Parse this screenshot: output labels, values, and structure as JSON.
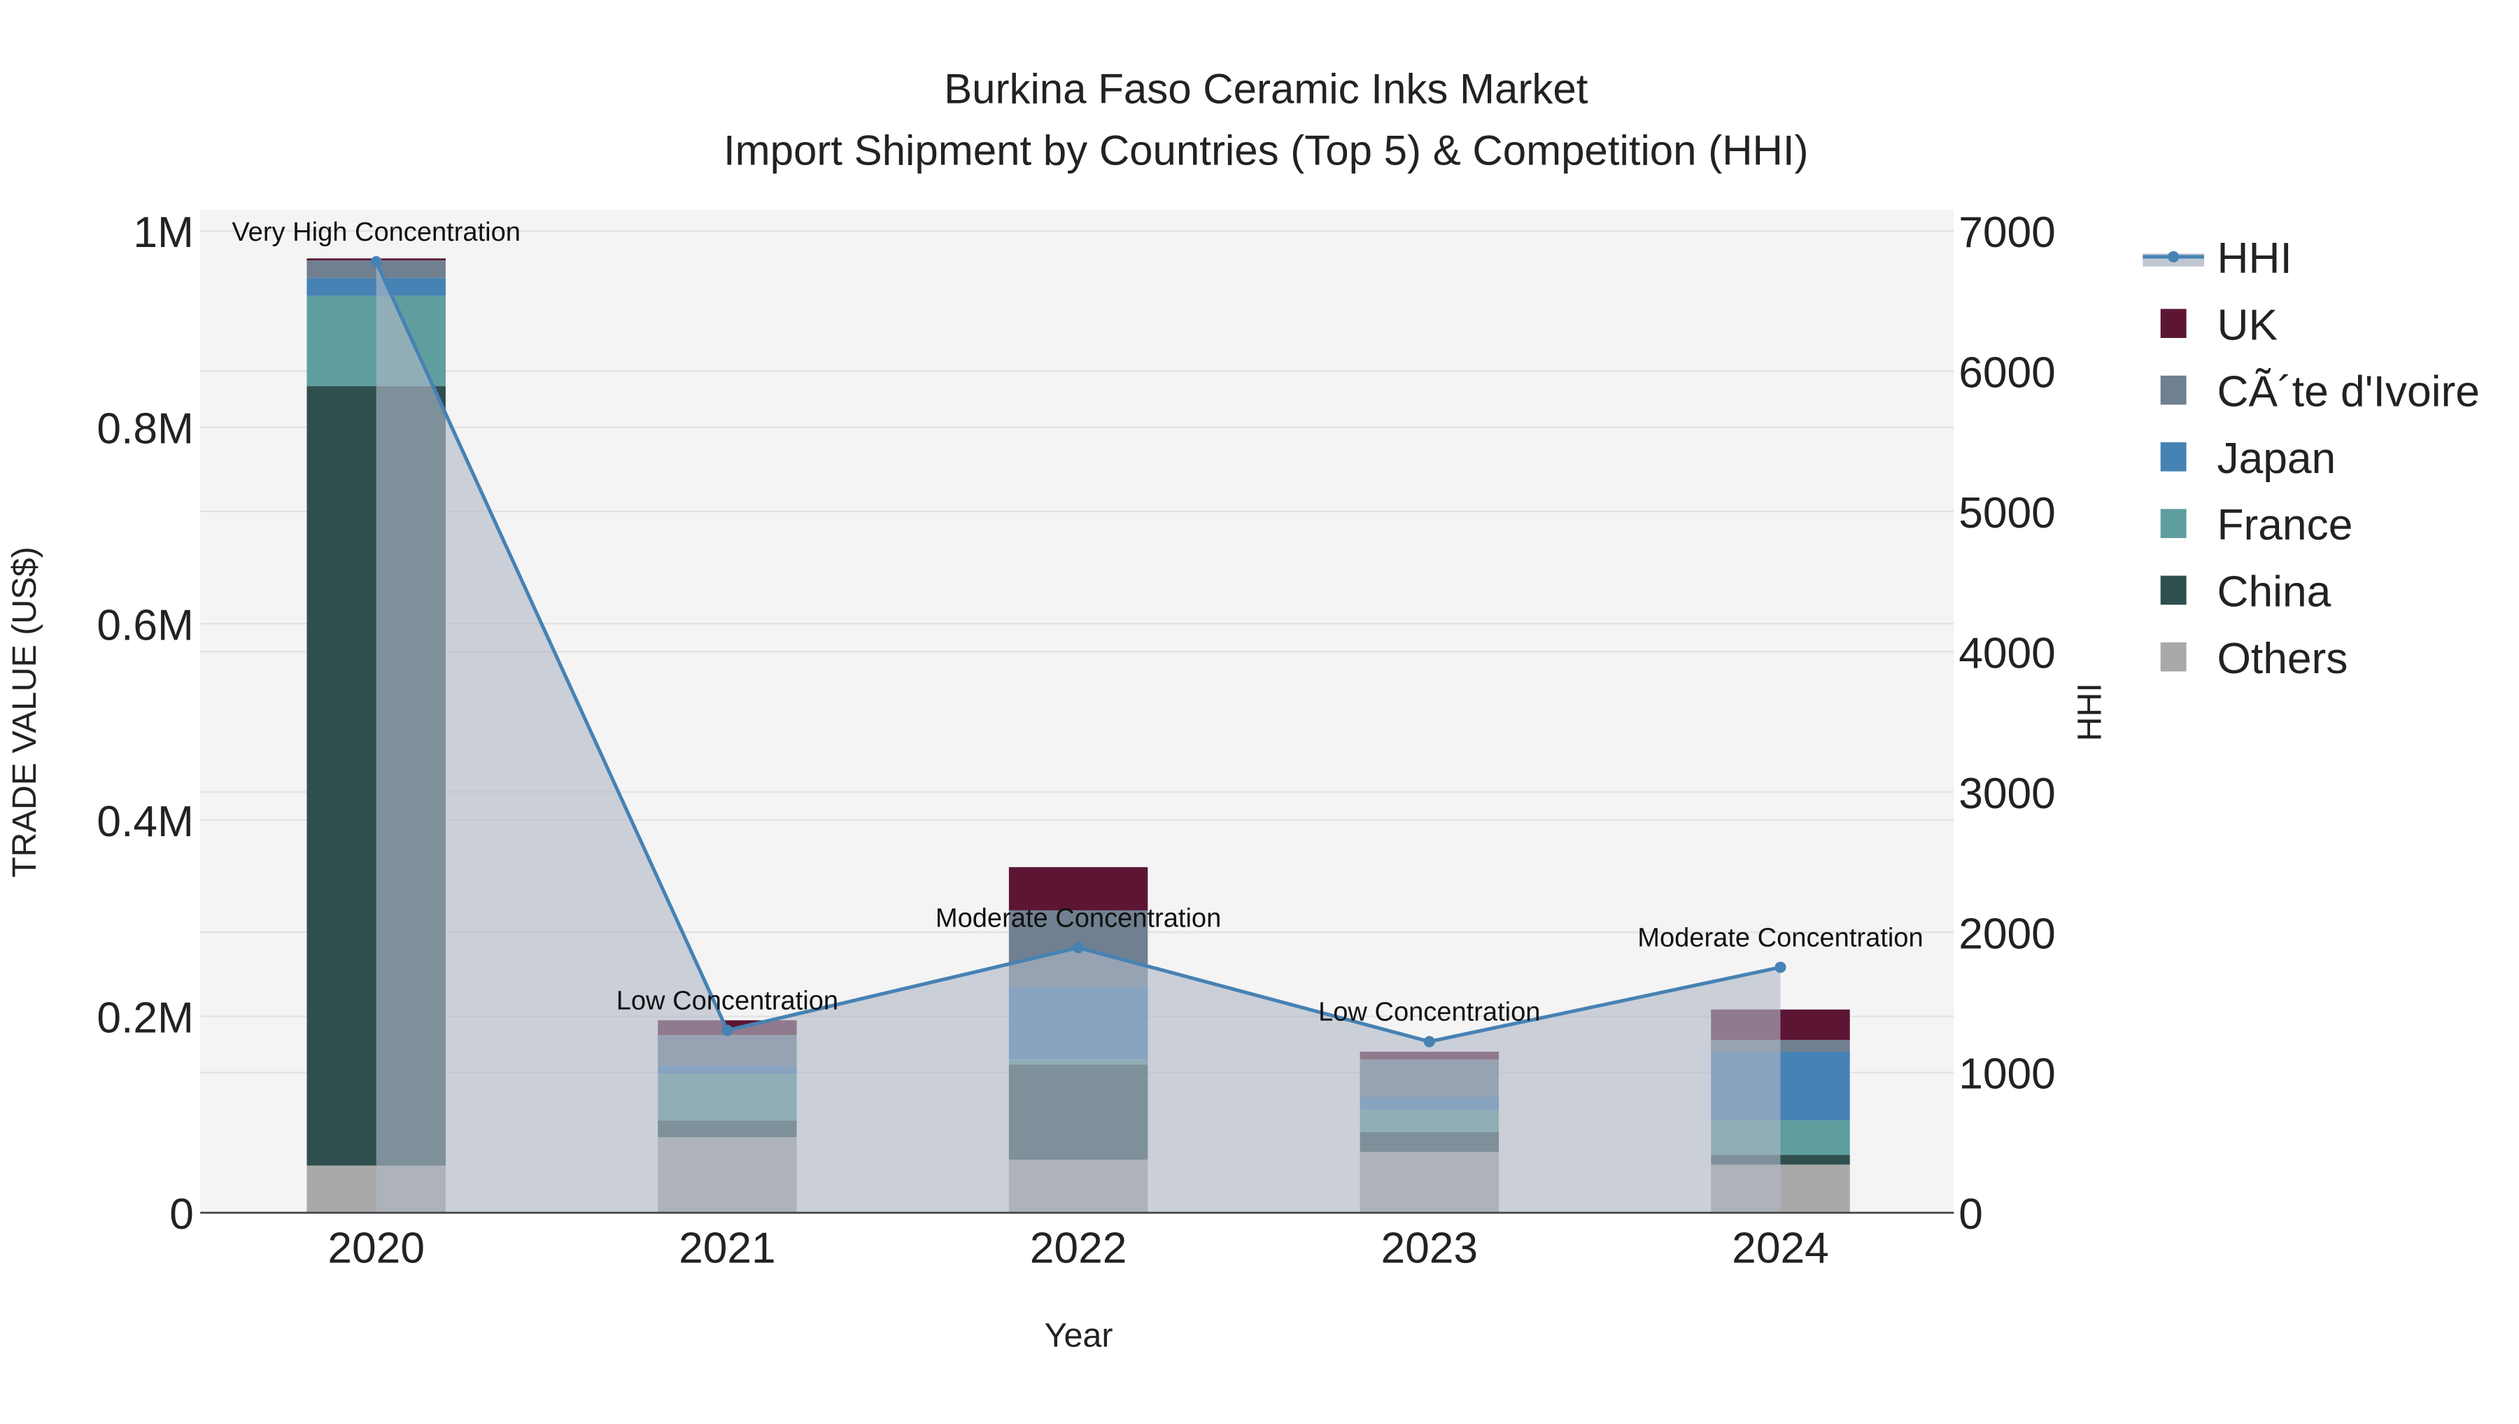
{
  "chart_data": {
    "type": "bar",
    "title_line1": "Burkina Faso Ceramic Inks Market",
    "title_line2": "Import Shipment by Countries (Top 5) & Competition (HHI)",
    "xlabel": "Year",
    "ylabel": "TRADE VALUE (US$)",
    "y2label": "HHI",
    "categories": [
      "2020",
      "2021",
      "2022",
      "2023",
      "2024"
    ],
    "ylim": [
      0,
      1000000
    ],
    "y2lim": [
      0,
      7000
    ],
    "yticks": [
      {
        "v": 0,
        "label": "0"
      },
      {
        "v": 200000,
        "label": "0.2M"
      },
      {
        "v": 400000,
        "label": "0.4M"
      },
      {
        "v": 600000,
        "label": "0.6M"
      },
      {
        "v": 800000,
        "label": "0.8M"
      },
      {
        "v": 1000000,
        "label": "1M"
      }
    ],
    "y2ticks": [
      {
        "v": 0,
        "label": "0"
      },
      {
        "v": 1000,
        "label": "1000"
      },
      {
        "v": 2000,
        "label": "2000"
      },
      {
        "v": 3000,
        "label": "3000"
      },
      {
        "v": 4000,
        "label": "4000"
      },
      {
        "v": 5000,
        "label": "5000"
      },
      {
        "v": 6000,
        "label": "6000"
      },
      {
        "v": 7000,
        "label": "7000"
      }
    ],
    "series": [
      {
        "name": "Others",
        "color": "#a9a9a9",
        "values": [
          48000,
          77000,
          54000,
          62000,
          49000
        ]
      },
      {
        "name": "China",
        "color": "#2f4f4f",
        "values": [
          794000,
          17000,
          97000,
          20000,
          10000
        ]
      },
      {
        "name": "France",
        "color": "#5f9e9e",
        "values": [
          92000,
          47000,
          5000,
          23000,
          35000
        ]
      },
      {
        "name": "Japan",
        "color": "#4682b4",
        "values": [
          18000,
          9000,
          74000,
          13000,
          70000
        ]
      },
      {
        "name": "CÃ´te d'Ivoire",
        "color": "#708090",
        "values": [
          18000,
          31000,
          78000,
          38000,
          12000
        ]
      },
      {
        "name": "UK",
        "color": "#5c1634",
        "values": [
          2000,
          15000,
          44000,
          8000,
          31000
        ]
      }
    ],
    "hhi": {
      "name": "HHI",
      "color": "#4682b4",
      "values": [
        6780,
        1300,
        1890,
        1220,
        1750
      ],
      "annotations": [
        "Very High Concentration",
        "Low Concentration",
        "Moderate Concentration",
        "Low Concentration",
        "Moderate Concentration"
      ]
    },
    "legend": [
      "HHI",
      "UK",
      "CÃ´te d'Ivoire",
      "Japan",
      "France",
      "China",
      "Others"
    ],
    "legend_position": "right",
    "grid": true
  }
}
